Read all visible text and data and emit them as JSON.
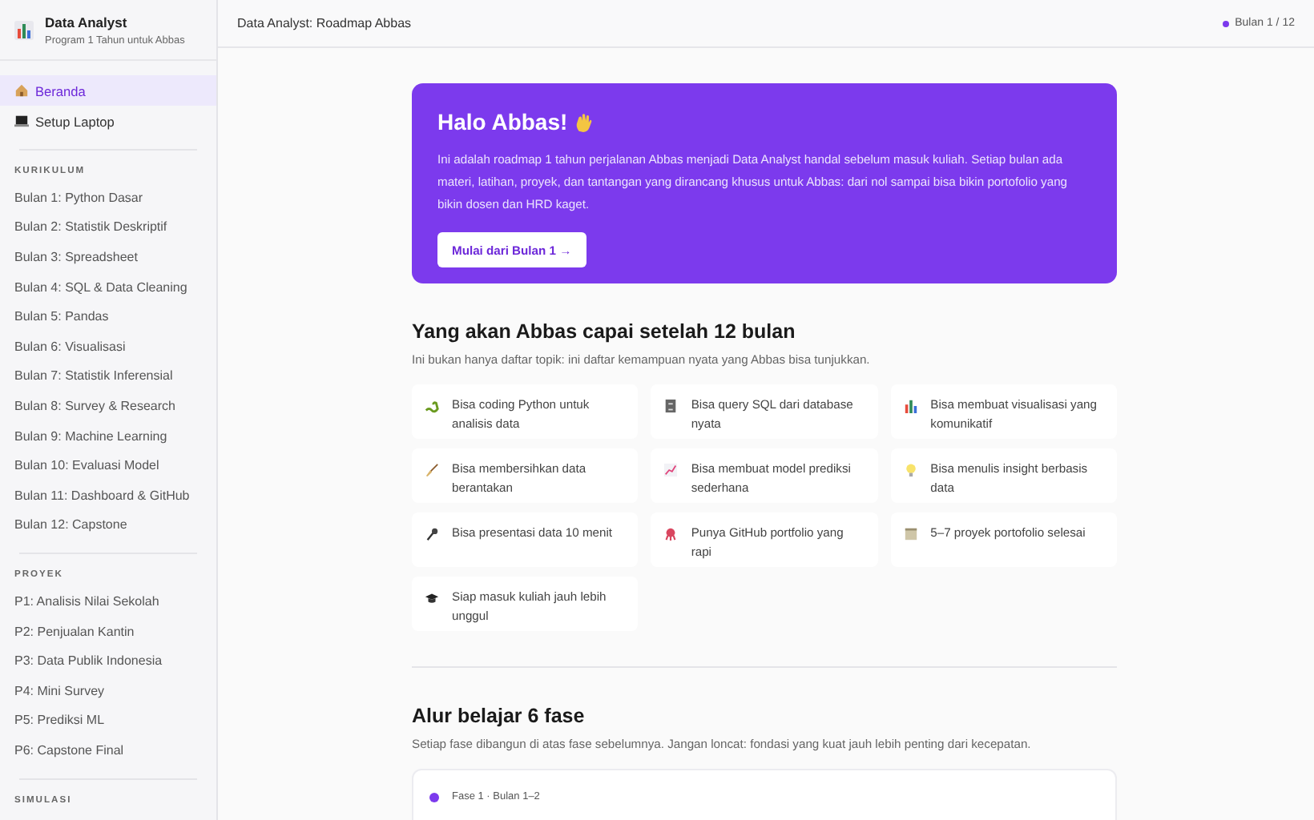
{
  "sidebar": {
    "brand": {
      "title": "Data Analyst",
      "subtitle": "Program 1 Tahun untuk Abbas"
    },
    "nav": [
      {
        "label": "Beranda",
        "selected": true
      },
      {
        "label": "Setup Laptop",
        "selected": false
      }
    ],
    "sections": [
      {
        "heading": "KURIKULUM",
        "items": [
          {
            "label": "Bulan 1: Python Dasar",
            "selected": false
          },
          {
            "label": "Bulan 2: Statistik Deskriptif",
            "selected": false
          },
          {
            "label": "Bulan 3: Spreadsheet",
            "selected": false
          },
          {
            "label": "Bulan 4: SQL & Data Cleaning",
            "selected": false
          },
          {
            "label": "Bulan 5: Pandas",
            "selected": false
          },
          {
            "label": "Bulan 6: Visualisasi",
            "selected": false
          },
          {
            "label": "Bulan 7: Statistik Inferensial",
            "selected": false
          },
          {
            "label": "Bulan 8: Survey & Research",
            "selected": false
          },
          {
            "label": "Bulan 9: Machine Learning",
            "selected": false
          },
          {
            "label": "Bulan 10: Evaluasi Model",
            "selected": false
          },
          {
            "label": "Bulan 11: Dashboard & GitHub",
            "selected": false
          },
          {
            "label": "Bulan 12: Capstone",
            "selected": false
          }
        ]
      },
      {
        "heading": "PROYEK",
        "items": [
          {
            "label": "P1: Analisis Nilai Sekolah",
            "selected": false
          },
          {
            "label": "P2: Penjualan Kantin",
            "selected": false
          },
          {
            "label": "P3: Data Publik Indonesia",
            "selected": false
          },
          {
            "label": "P4: Mini Survey",
            "selected": false
          },
          {
            "label": "P5: Prediksi ML",
            "selected": false
          },
          {
            "label": "P6: Capstone Final",
            "selected": false
          }
        ]
      },
      {
        "heading": "SIMULASI"
      }
    ]
  },
  "topbar": {
    "title": "Data Analyst: Roadmap Abbas",
    "progress": "Bulan 1 / 12"
  },
  "hero": {
    "title": "Halo Abbas!",
    "text": "Ini adalah roadmap 1 tahun perjalanan Abbas menjadi Data Analyst handal sebelum masuk kuliah. Setiap bulan ada materi, latihan, proyek, dan tantangan yang dirancang khusus untuk Abbas: dari nol sampai bisa bikin portofolio yang bikin dosen dan HRD kaget.",
    "button": "Mulai dari Bulan 1 →"
  },
  "goals": {
    "title": "Yang akan Abbas capai setelah 12 bulan",
    "subtitle": "Ini bukan hanya daftar topik: ini daftar kemampuan nyata yang Abbas bisa tunjukkan.",
    "items": [
      "Bisa coding Python untuk analisis data",
      "Bisa query SQL dari database nyata",
      "Bisa membuat visualisasi yang komunikatif",
      "Bisa membersihkan data berantakan",
      "Bisa membuat model prediksi sederhana",
      "Bisa menulis insight berbasis data",
      "Bisa presentasi data 10 menit",
      "Punya GitHub portfolio yang rapi",
      "5–7 proyek portofolio selesai",
      "Siap masuk kuliah jauh lebih unggul"
    ]
  },
  "phases": {
    "title": "Alur belajar 6 fase",
    "subtitle": "Setiap fase dibangun di atas fase sebelumnya. Jangan loncat: fondasi yang kuat jauh lebih penting dari kecepatan.",
    "items": [
      {
        "label": "Fase 1 · Bulan 1–2",
        "color": "#7c3aed"
      }
    ]
  }
}
